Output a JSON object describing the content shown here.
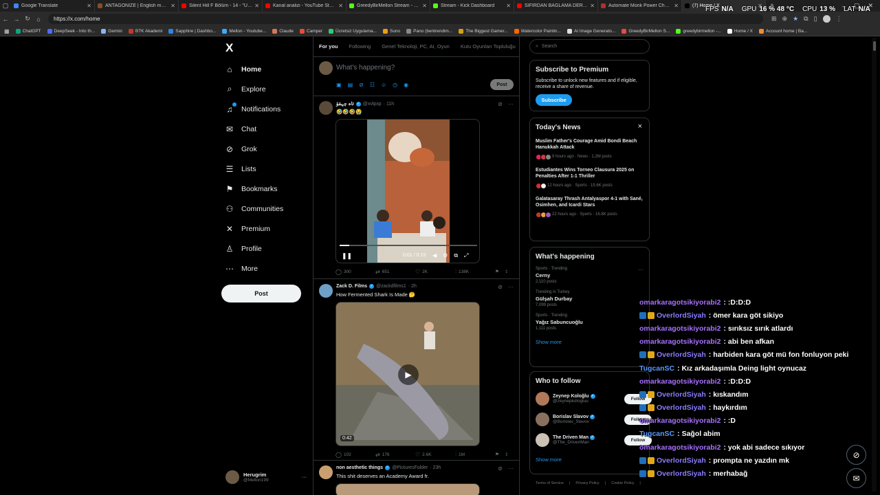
{
  "tabs": [
    {
      "label": "Google Translate",
      "color": "#4285f4"
    },
    {
      "label": "ANTAGONIZE | English meaning -",
      "color": "#8a4b2b"
    },
    {
      "label": "Silent Hill F Bölüm - 14 - \"Uyuyan",
      "color": "#ff0000"
    },
    {
      "label": "Kanal analizi - YouTube Studio",
      "color": "#ff0000"
    },
    {
      "label": "GreedyBirMellon Stream - Watch",
      "color": "#53fc18"
    },
    {
      "label": "Stream - Kick Dashboard",
      "color": "#53fc18"
    },
    {
      "label": "SIFIRDAN BAĞLAMA DERSİ 3 (EN",
      "color": "#ff0000"
    },
    {
      "label": "Automate Monk Power Charges V",
      "color": "#b03030"
    },
    {
      "label": "(7) Home / X",
      "color": "#000000"
    }
  ],
  "overlay_stats": [
    {
      "label": "FPS",
      "value": "N/A"
    },
    {
      "label": "GPU",
      "value": "16 %  48 °C"
    },
    {
      "label": "CPU",
      "value": "13 %"
    },
    {
      "label": "LAT",
      "value": "N/A"
    }
  ],
  "address": {
    "url": "https://x.com/home"
  },
  "bookmarks": [
    {
      "label": "ChatGPT",
      "color": "#10a37f"
    },
    {
      "label": "DeepSeek - Into th...",
      "color": "#4d6bfe"
    },
    {
      "label": "Gemini",
      "color": "#8ab4f8"
    },
    {
      "label": "BTK Akademi",
      "color": "#c0392b"
    },
    {
      "label": "Sapphire | Dashbo...",
      "color": "#2e86de"
    },
    {
      "label": "Mellon - Youtube...",
      "color": "#3fa9f5"
    },
    {
      "label": "Claude",
      "color": "#d97757"
    },
    {
      "label": "Camper",
      "color": "#e74c3c"
    },
    {
      "label": "Ücretsiz Uygulama...",
      "color": "#2ecc71"
    },
    {
      "label": "Suno",
      "color": "#f39c12"
    },
    {
      "label": "Pano (bentrendim...",
      "color": "#888888"
    },
    {
      "label": "The Biggest Gamer...",
      "color": "#d4a017"
    },
    {
      "label": "Watercolor Paintin...",
      "color": "#ff6600"
    },
    {
      "label": "AI Image Generato...",
      "color": "#dddddd"
    },
    {
      "label": "GreedyBirMellon S...",
      "color": "#e74c3c"
    },
    {
      "label": "greedybirmellon -...",
      "color": "#53fc18"
    },
    {
      "label": "Home / X",
      "color": "#ffffff"
    },
    {
      "label": "Account home | Ba...",
      "color": "#f28b30"
    }
  ],
  "nav": {
    "logo": "X",
    "items": [
      {
        "label": "Home",
        "icon": "home-icon",
        "glyph": "⌂"
      },
      {
        "label": "Explore",
        "icon": "search-icon",
        "glyph": "⌕"
      },
      {
        "label": "Notifications",
        "icon": "bell-icon",
        "glyph": "♫"
      },
      {
        "label": "Chat",
        "icon": "mail-icon",
        "glyph": "✉"
      },
      {
        "label": "Grok",
        "icon": "grok-icon",
        "glyph": "⊘"
      },
      {
        "label": "Lists",
        "icon": "list-icon",
        "glyph": "☰"
      },
      {
        "label": "Bookmarks",
        "icon": "bookmark-icon",
        "glyph": "⚑"
      },
      {
        "label": "Communities",
        "icon": "people-icon",
        "glyph": "⚇"
      },
      {
        "label": "Premium",
        "icon": "x-icon",
        "glyph": "✕"
      },
      {
        "label": "Profile",
        "icon": "person-icon",
        "glyph": "♙"
      },
      {
        "label": "More",
        "icon": "more-circle-icon",
        "glyph": "⋯"
      }
    ],
    "post_label": "Post"
  },
  "account": {
    "name": "Herugrim",
    "handle": "@Mellon199",
    "more": "···"
  },
  "feed": {
    "tabs": [
      "For you",
      "Following",
      "Genel Teknoloji, PC, AI, Oyun",
      "Kutu Oyunları Topluluğu"
    ],
    "compose_placeholder": "What's happening?",
    "compose_post": "Post",
    "tweets": [
      {
        "name": "ئاہ چہقۆ",
        "handle": "@xvlpxp",
        "time": "· 11h",
        "text": "🤣🤣🤣😭",
        "video_time": "0:01 / 0:15",
        "replies": "300",
        "reposts": "651",
        "likes": "2K",
        "views": "138K"
      },
      {
        "name": "Zack D. Films",
        "handle": "@zackdfilms1",
        "time": "· 2h",
        "text": "How Fermented Shark Is Made 🤔",
        "duration": "0:42",
        "replies": "102",
        "reposts": "176",
        "likes": "2.6K",
        "views": "1M"
      },
      {
        "name": "non aesthetic things",
        "handle": "@PicturesFolder",
        "time": "· 23h",
        "text": "This shit deserves an Academy Award fr."
      }
    ]
  },
  "right": {
    "search_placeholder": "Search",
    "premium": {
      "title": "Subscribe to Premium",
      "text": "Subscribe to unlock new features and if eligible, receive a share of revenue.",
      "button": "Subscribe"
    },
    "news": {
      "title": "Today's News",
      "close": "×",
      "items": [
        {
          "title": "Muslim Father's Courage Amid Bondi Beach Hanukkah Attack",
          "meta": "9 hours ago · News · 1.2M posts"
        },
        {
          "title": "Estudiantes Wins Torneo Clausura 2025 on Penalties After 1-1 Thriller",
          "meta": "12 hours ago · Sports · 15.6K posts"
        },
        {
          "title": "Galatasaray Thrash Antalyaspor 4-1 with Sané, Osimhen, and Icardi Stars",
          "meta": "22 hours ago · Sports · 16.8K posts"
        }
      ]
    },
    "happening": {
      "title": "What's happening",
      "trends": [
        {
          "context": "Sports · Trending",
          "topic": "Cerny",
          "posts": "2,110 posts"
        },
        {
          "context": "Trending in Turkey",
          "topic": "Gülşah Durbay",
          "posts": "7,099 posts"
        },
        {
          "context": "Sports · Trending",
          "topic": "Yağız Sabuncuoğlu",
          "posts": "1,111 posts"
        }
      ],
      "show_more": "Show more"
    },
    "who_to_follow": {
      "title": "Who to follow",
      "users": [
        {
          "name": "Zeynep Koloğlu",
          "handle": "@zeynepkologluu",
          "button": "Follow"
        },
        {
          "name": "Borislav Slavov",
          "handle": "@Borislav_Slavov",
          "button": "Follow"
        },
        {
          "name": "The Driven Man",
          "handle": "@The_DrivenMan",
          "button": "Follow"
        }
      ],
      "show_more": "Show more"
    },
    "footer": [
      "Terms of Service",
      "|",
      "Privacy Policy",
      "|",
      "Cookie Policy",
      "|"
    ]
  },
  "chat": [
    {
      "user": "omarkaragotsikiyorabi2",
      "color": "#a970ff",
      "badges": false,
      "msg": ": :D:D:D"
    },
    {
      "user": "OverlordSiyah",
      "color": "#8a7cff",
      "badges": true,
      "msg": ": ömer kara göt sikiyo"
    },
    {
      "user": "omarkaragotsikiyorabi2",
      "color": "#a970ff",
      "badges": false,
      "msg": ": sırıksız sırık atlardı"
    },
    {
      "user": "omarkaragotsikiyorabi2",
      "color": "#a970ff",
      "badges": false,
      "msg": ": abi ben afkan"
    },
    {
      "user": "OverlordSiyah",
      "color": "#8a7cff",
      "badges": true,
      "msg": ": harbiden kara göt mü fon fonluyon peki"
    },
    {
      "user": "TugcanSC",
      "color": "#5b9bff",
      "badges": false,
      "msg": ": Kız arkadaşımla Deing light oynucaz"
    },
    {
      "user": "omarkaragotsikiyorabi2",
      "color": "#a970ff",
      "badges": false,
      "msg": ": :D:D:D"
    },
    {
      "user": "OverlordSiyah",
      "color": "#8a7cff",
      "badges": true,
      "msg": ": kıskandım"
    },
    {
      "user": "OverlordSiyah",
      "color": "#8a7cff",
      "badges": true,
      "msg": ": haykırdım"
    },
    {
      "user": "omarkaragotsikiyorabi2",
      "color": "#a970ff",
      "badges": false,
      "msg": ": :D"
    },
    {
      "user": "TugcanSC",
      "color": "#5b9bff",
      "badges": false,
      "msg": ": Sağol abim"
    },
    {
      "user": "omarkaragotsikiyorabi2",
      "color": "#a970ff",
      "badges": false,
      "msg": ": yok abi sadece sıkıyor"
    },
    {
      "user": "OverlordSiyah",
      "color": "#8a7cff",
      "badges": true,
      "msg": ": prompta ne yazdın mk"
    },
    {
      "user": "OverlordSiyah",
      "color": "#8a7cff",
      "badges": true,
      "msg": ": merhabağ"
    }
  ]
}
